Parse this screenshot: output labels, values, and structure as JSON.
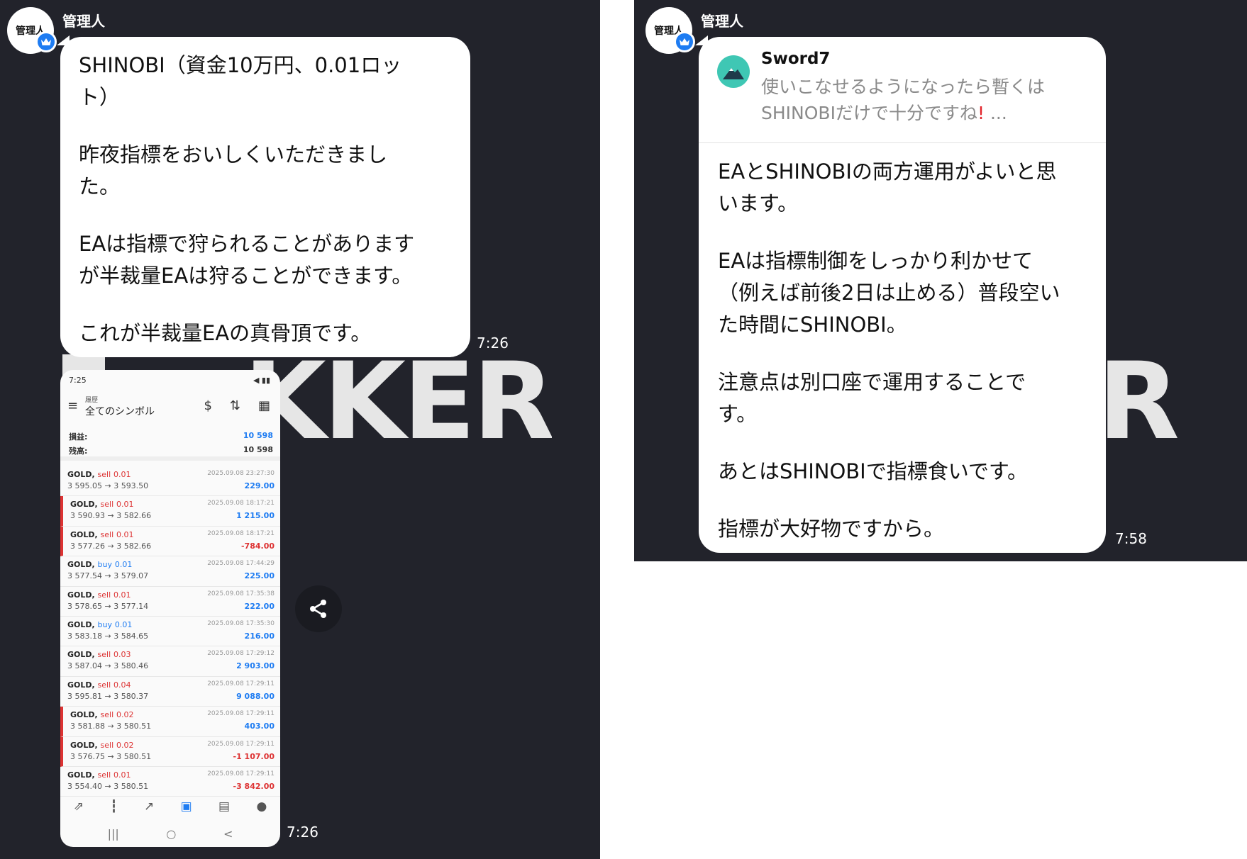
{
  "left": {
    "sender_name": "管理人",
    "avatar_label": "管理人",
    "message_lines": [
      "SHINOBI（資金10万円、0.01ロッ",
      "ト）",
      "昨夜指標をおいしくいただきまし",
      "た。",
      "EAは指標で狩られることがあります",
      "が半裁量EAは狩ることができます。",
      "これが半裁量EAの真骨頂です。"
    ],
    "message_time": "7:26",
    "image_time": "7:26",
    "watermark_text": "KKER",
    "screenshot": {
      "status_time": "7:25",
      "header_sub": "履歴",
      "header_title": "全てのシンボル",
      "summary": [
        {
          "label": "損益:",
          "value": "10 598"
        },
        {
          "label": "残高:",
          "value": "10 598"
        }
      ],
      "trades": [
        {
          "symbol": "GOLD,",
          "dir": "sell",
          "lot": "0.01",
          "prices": "3 595.05 → 3 593.50",
          "date": "2025.09.08 23:27:30",
          "profit": "229.00"
        },
        {
          "symbol": "GOLD,",
          "dir": "sell",
          "lot": "0.01",
          "prices": "3 590.93 → 3 582.66",
          "date": "2025.09.08 18:17:21",
          "profit": "1 215.00"
        },
        {
          "symbol": "GOLD,",
          "dir": "sell",
          "lot": "0.01",
          "prices": "3 577.26 → 3 582.66",
          "date": "2025.09.08 18:17:21",
          "profit": "-784.00"
        },
        {
          "symbol": "GOLD,",
          "dir": "buy",
          "lot": "0.01",
          "prices": "3 577.54 → 3 579.07",
          "date": "2025.09.08 17:44:29",
          "profit": "225.00"
        },
        {
          "symbol": "GOLD,",
          "dir": "sell",
          "lot": "0.01",
          "prices": "3 578.65 → 3 577.14",
          "date": "2025.09.08 17:35:38",
          "profit": "222.00"
        },
        {
          "symbol": "GOLD,",
          "dir": "buy",
          "lot": "0.01",
          "prices": "3 583.18 → 3 584.65",
          "date": "2025.09.08 17:35:30",
          "profit": "216.00"
        },
        {
          "symbol": "GOLD,",
          "dir": "sell",
          "lot": "0.03",
          "prices": "3 587.04 → 3 580.46",
          "date": "2025.09.08 17:29:12",
          "profit": "2 903.00"
        },
        {
          "symbol": "GOLD,",
          "dir": "sell",
          "lot": "0.04",
          "prices": "3 595.81 → 3 580.37",
          "date": "2025.09.08 17:29:11",
          "profit": "9 088.00"
        },
        {
          "symbol": "GOLD,",
          "dir": "sell",
          "lot": "0.02",
          "prices": "3 581.88 → 3 580.51",
          "date": "2025.09.08 17:29:11",
          "profit": "403.00"
        },
        {
          "symbol": "GOLD,",
          "dir": "sell",
          "lot": "0.02",
          "prices": "3 576.75 → 3 580.51",
          "date": "2025.09.08 17:29:11",
          "profit": "-1 107.00"
        },
        {
          "symbol": "GOLD,",
          "dir": "sell",
          "lot": "0.01",
          "prices": "3 554.40 → 3 580.51",
          "date": "2025.09.08 17:29:11",
          "profit": "-3 842.00"
        }
      ]
    }
  },
  "right": {
    "sender_name": "管理人",
    "avatar_label": "管理人",
    "watermark_text": "R",
    "reply": {
      "name": "Sword7",
      "text_line1": "使いこなせるようになったら暫くは",
      "text_line2": "SHINOBIだけで十分ですね",
      "ellipsis": "..."
    },
    "message_lines": [
      "EAとSHINOBIの両方運用がよいと思",
      "います。",
      "EAは指標制御をしっかり利かせて",
      "（例えば前後2日は止める）普段空い",
      "た時間にSHINOBI。",
      "注意点は別口座で運用することで",
      "す。",
      "あとはSHINOBIで指標食いです。",
      "指標が大好物ですから。"
    ],
    "message_time": "7:58"
  }
}
